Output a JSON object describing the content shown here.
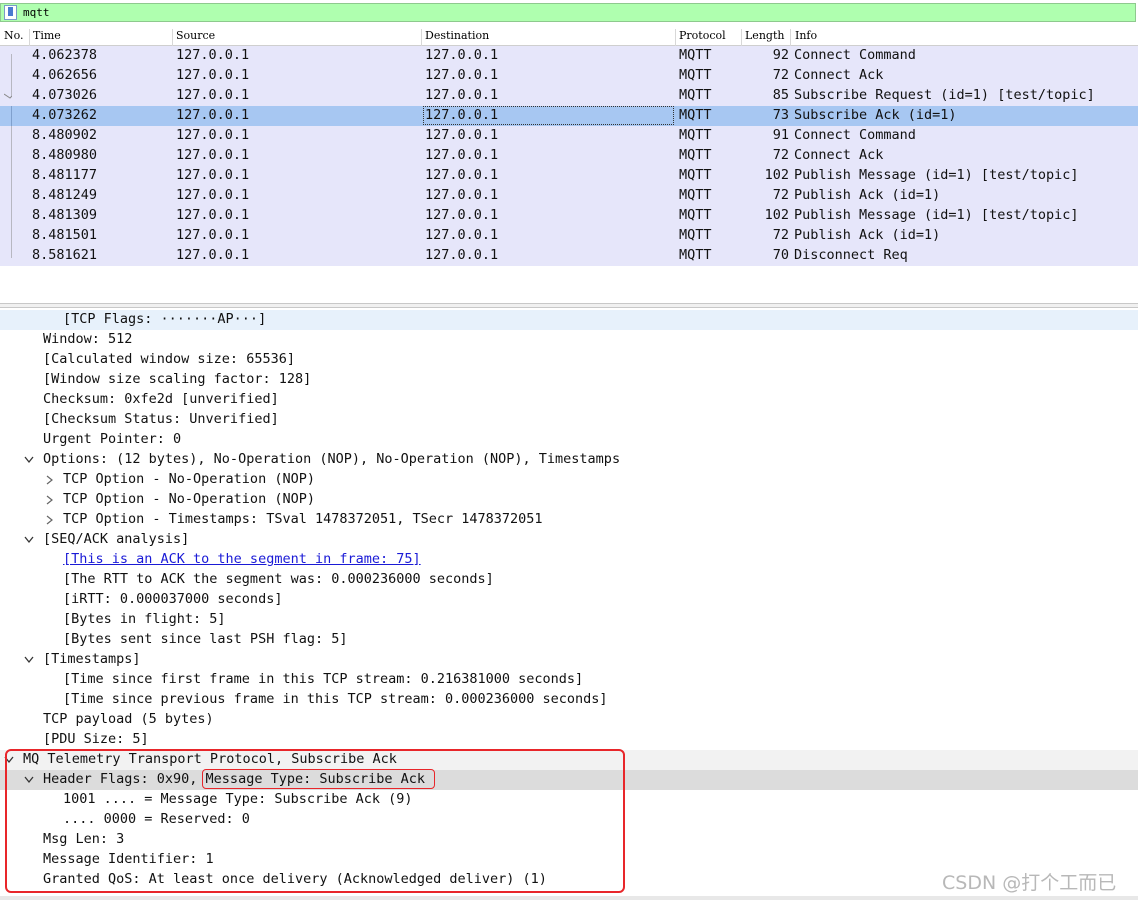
{
  "filter": {
    "text": "mqtt"
  },
  "columns": {
    "no": "No.",
    "time": "Time",
    "source": "Source",
    "destination": "Destination",
    "protocol": "Protocol",
    "length": "Length",
    "info": "Info"
  },
  "packets": [
    {
      "time": "4.062378",
      "source": "127.0.0.1",
      "destination": "127.0.0.1",
      "protocol": "MQTT",
      "length": "92",
      "info": "Connect Command"
    },
    {
      "time": "4.062656",
      "source": "127.0.0.1",
      "destination": "127.0.0.1",
      "protocol": "MQTT",
      "length": "72",
      "info": "Connect Ack"
    },
    {
      "time": "4.073026",
      "source": "127.0.0.1",
      "destination": "127.0.0.1",
      "protocol": "MQTT",
      "length": "85",
      "info": "Subscribe Request (id=1) [test/topic]"
    },
    {
      "time": "4.073262",
      "source": "127.0.0.1",
      "destination": "127.0.0.1",
      "protocol": "MQTT",
      "length": "73",
      "info": "Subscribe Ack (id=1)"
    },
    {
      "time": "8.480902",
      "source": "127.0.0.1",
      "destination": "127.0.0.1",
      "protocol": "MQTT",
      "length": "91",
      "info": "Connect Command"
    },
    {
      "time": "8.480980",
      "source": "127.0.0.1",
      "destination": "127.0.0.1",
      "protocol": "MQTT",
      "length": "72",
      "info": "Connect Ack"
    },
    {
      "time": "8.481177",
      "source": "127.0.0.1",
      "destination": "127.0.0.1",
      "protocol": "MQTT",
      "length": "102",
      "info": "Publish Message (id=1) [test/topic]"
    },
    {
      "time": "8.481249",
      "source": "127.0.0.1",
      "destination": "127.0.0.1",
      "protocol": "MQTT",
      "length": "72",
      "info": "Publish Ack (id=1)"
    },
    {
      "time": "8.481309",
      "source": "127.0.0.1",
      "destination": "127.0.0.1",
      "protocol": "MQTT",
      "length": "102",
      "info": "Publish Message (id=1) [test/topic]"
    },
    {
      "time": "8.481501",
      "source": "127.0.0.1",
      "destination": "127.0.0.1",
      "protocol": "MQTT",
      "length": "72",
      "info": "Publish Ack (id=1)"
    },
    {
      "time": "8.581621",
      "source": "127.0.0.1",
      "destination": "127.0.0.1",
      "protocol": "MQTT",
      "length": "70",
      "info": "Disconnect Req"
    }
  ],
  "details": [
    {
      "indent": 3,
      "text": "[TCP Flags: ·······AP···]"
    },
    {
      "indent": 2,
      "text": "Window: 512"
    },
    {
      "indent": 2,
      "text": "[Calculated window size: 65536]"
    },
    {
      "indent": 2,
      "text": "[Window size scaling factor: 128]"
    },
    {
      "indent": 2,
      "text": "Checksum: 0xfe2d [unverified]"
    },
    {
      "indent": 2,
      "text": "[Checksum Status: Unverified]"
    },
    {
      "indent": 2,
      "text": "Urgent Pointer: 0"
    },
    {
      "indent": 2,
      "arrow": "open",
      "text": "Options: (12 bytes), No-Operation (NOP), No-Operation (NOP), Timestamps"
    },
    {
      "indent": 3,
      "arrow": "closed",
      "text": "TCP Option - No-Operation (NOP)"
    },
    {
      "indent": 3,
      "arrow": "closed",
      "text": "TCP Option - No-Operation (NOP)"
    },
    {
      "indent": 3,
      "arrow": "closed",
      "text": "TCP Option - Timestamps: TSval 1478372051, TSecr 1478372051"
    },
    {
      "indent": 2,
      "arrow": "open",
      "text": "[SEQ/ACK analysis]"
    },
    {
      "indent": 3,
      "link": true,
      "text": "[This is an ACK to the segment in frame: 75]"
    },
    {
      "indent": 3,
      "text": "[The RTT to ACK the segment was: 0.000236000 seconds]"
    },
    {
      "indent": 3,
      "text": "[iRTT: 0.000037000 seconds]"
    },
    {
      "indent": 3,
      "text": "[Bytes in flight: 5]"
    },
    {
      "indent": 3,
      "text": "[Bytes sent since last PSH flag: 5]"
    },
    {
      "indent": 2,
      "arrow": "open",
      "text": "[Timestamps]"
    },
    {
      "indent": 3,
      "text": "[Time since first frame in this TCP stream: 0.216381000 seconds]"
    },
    {
      "indent": 3,
      "text": "[Time since previous frame in this TCP stream: 0.000236000 seconds]"
    },
    {
      "indent": 2,
      "text": "TCP payload (5 bytes)"
    },
    {
      "indent": 2,
      "text": "[PDU Size: 5]"
    },
    {
      "indent": 1,
      "arrow": "open",
      "text": "MQ Telemetry Transport Protocol, Subscribe Ack"
    },
    {
      "indent": 2,
      "arrow": "open",
      "text": "Header Flags: 0x90, Message Type: Subscribe Ack"
    },
    {
      "indent": 3,
      "text": "1001 .... = Message Type: Subscribe Ack (9)"
    },
    {
      "indent": 3,
      "text": ".... 0000 = Reserved: 0"
    },
    {
      "indent": 2,
      "text": "Msg Len: 3"
    },
    {
      "indent": 2,
      "text": "Message Identifier: 1"
    },
    {
      "indent": 2,
      "text": "Granted QoS: At least once delivery (Acknowledged deliver) (1)"
    }
  ],
  "watermark": "CSDN @打个工而已",
  "colors": {
    "row_bg": "#e6e6fa",
    "selected_bg": "#a7c7f2",
    "filter_bg": "#afffaf",
    "annotation": "#e8262a"
  }
}
